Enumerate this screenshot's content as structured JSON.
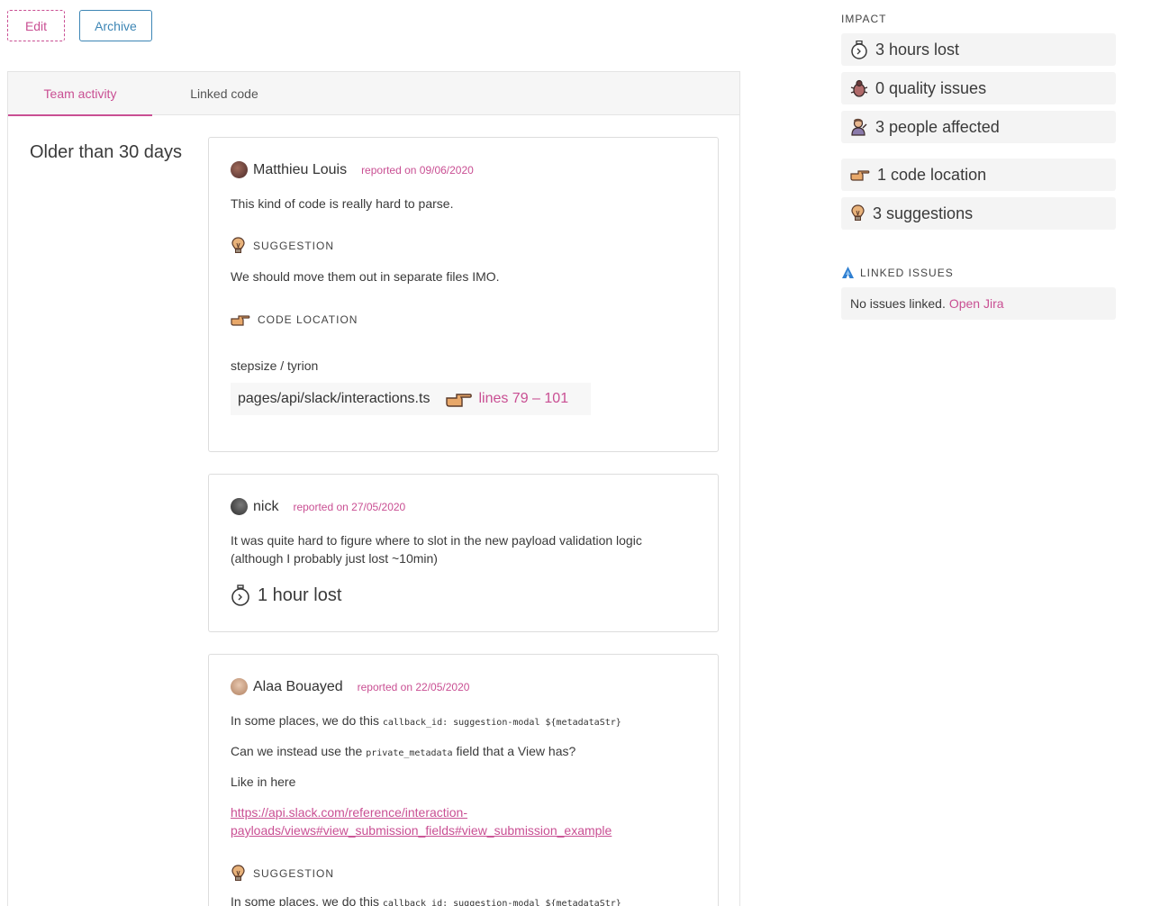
{
  "toolbar": {
    "edit_label": "Edit",
    "archive_label": "Archive"
  },
  "tabs": [
    {
      "label": "Team activity",
      "active": true
    },
    {
      "label": "Linked code",
      "active": false
    }
  ],
  "section_title": "Older than 30 days",
  "activities": [
    {
      "author": "Matthieu Louis",
      "reported": "reported on 09/06/2020",
      "comment": "This kind of code is really hard to parse.",
      "suggestion_label": "SUGGESTION",
      "suggestion_text": "We should move them out in separate files IMO.",
      "code_location_label": "CODE LOCATION",
      "repo": "stepsize / tyrion",
      "file": "pages/api/slack/interactions.ts",
      "lines": "lines 79 – 101"
    },
    {
      "author": "nick",
      "reported": "reported on 27/05/2020",
      "comment_line1": "It was quite hard to figure where to slot in the new payload validation logic",
      "comment_line2": "(although I probably just lost ~10min)",
      "time_lost": "1 hour lost"
    },
    {
      "author": "Alaa Bouayed",
      "reported": "reported on 22/05/2020",
      "p1_text": "In some places, we do this",
      "p1_code": "callback_id: suggestion-modal ${metadataStr}",
      "p2_text": "Can we instead use the",
      "p2_code": "private_metadata",
      "p2_text_after": "field that a View has?",
      "p3_text": "Like in here",
      "link_line1": "https://api.slack.com/reference/interaction-",
      "link_line2": "payloads/views#view_submission_fields#view_submission_example",
      "suggestion_label": "SUGGESTION",
      "suggestion_text": "In some places, we do this",
      "suggestion_code": "callback_id: suggestion-modal ${metadataStr}"
    }
  ],
  "impact": {
    "label": "IMPACT",
    "metrics": [
      {
        "icon": "stopwatch-icon",
        "text": "3 hours lost"
      },
      {
        "icon": "bug-icon",
        "text": "0 quality issues"
      },
      {
        "icon": "person-icon",
        "text": "3 people affected"
      },
      {
        "icon": "pointing-hand-icon",
        "text": "1 code location"
      },
      {
        "icon": "lightbulb-icon",
        "text": "3 suggestions"
      }
    ]
  },
  "linked_issues": {
    "label": "LINKED ISSUES",
    "empty_text": "No issues linked.",
    "open_jira": "Open Jira"
  },
  "colors": {
    "accent": "#c94f93",
    "secondary": "#3d86b5"
  }
}
